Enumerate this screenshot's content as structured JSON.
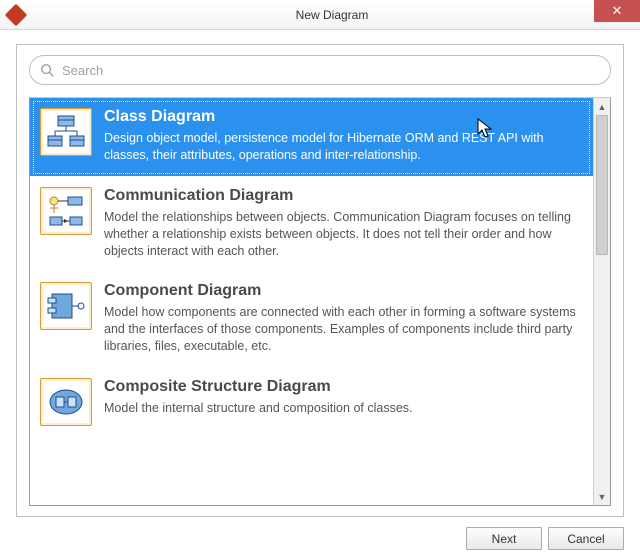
{
  "window": {
    "title": "New Diagram"
  },
  "search": {
    "placeholder": "Search",
    "value": ""
  },
  "list": [
    {
      "title": "Class Diagram",
      "desc": "Design object model, persistence model for Hibernate ORM and REST API with classes, their attributes, operations and inter-relationship.",
      "selected": true,
      "icon": "class-diagram"
    },
    {
      "title": "Communication Diagram",
      "desc": "Model the relationships between objects. Communication Diagram focuses on telling whether a relationship exists between objects. It does not tell their order and how objects interact with each other.",
      "selected": false,
      "icon": "communication-diagram"
    },
    {
      "title": "Component Diagram",
      "desc": "Model how components are connected with each other in forming a software systems and the interfaces of those components. Examples of components include third party libraries, files, executable, etc.",
      "selected": false,
      "icon": "component-diagram"
    },
    {
      "title": "Composite Structure Diagram",
      "desc": "Model the internal structure and composition of classes.",
      "selected": false,
      "icon": "composite-structure-diagram"
    }
  ],
  "buttons": {
    "next": "Next",
    "cancel": "Cancel"
  }
}
